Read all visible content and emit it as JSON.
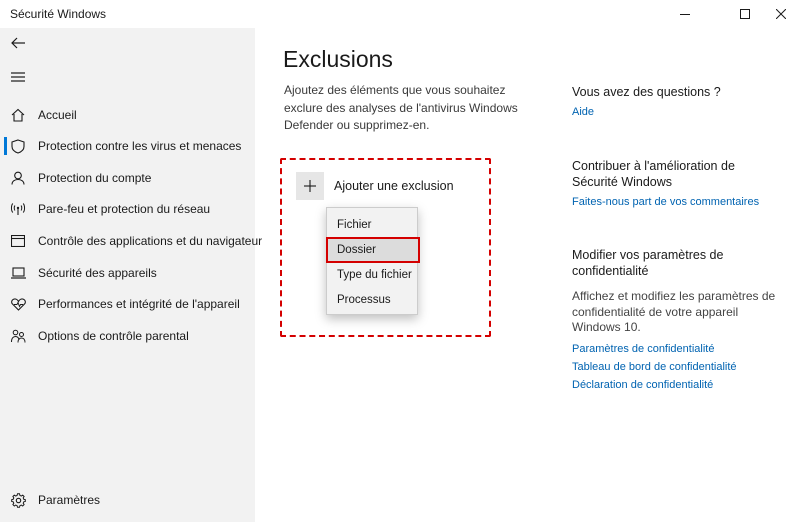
{
  "window": {
    "title": "Sécurité Windows"
  },
  "sidebar": {
    "items": [
      {
        "label": "Accueil",
        "icon": "home-icon"
      },
      {
        "label": "Protection contre les virus et menaces",
        "icon": "shield-icon"
      },
      {
        "label": "Protection du compte",
        "icon": "person-icon"
      },
      {
        "label": "Pare-feu et protection du réseau",
        "icon": "wireless-icon"
      },
      {
        "label": "Contrôle des applications et du navigateur",
        "icon": "app-browser-icon"
      },
      {
        "label": "Sécurité des appareils",
        "icon": "laptop-icon"
      },
      {
        "label": "Performances et intégrité de l'appareil",
        "icon": "heart-icon"
      },
      {
        "label": "Options de contrôle parental",
        "icon": "family-icon"
      }
    ],
    "settings_label": "Paramètres"
  },
  "main": {
    "title": "Exclusions",
    "description": "Ajoutez des éléments que vous souhaitez exclure des analyses de l'antivirus Windows Defender ou supprimez-en.",
    "add_exclusion_label": "Ajouter une exclusion",
    "menu": {
      "items": [
        "Fichier",
        "Dossier",
        "Type du fichier",
        "Processus"
      ],
      "highlighted": "Dossier"
    }
  },
  "right": {
    "questions": {
      "heading": "Vous avez des questions ?",
      "link": "Aide"
    },
    "contribute": {
      "heading": "Contribuer à l'amélioration de Sécurité Windows",
      "link": "Faites-nous part de vos commentaires"
    },
    "privacy": {
      "heading": "Modifier vos paramètres de confidentialité",
      "text": "Affichez et modifiez les paramètres de confidentialité de votre appareil Windows 10.",
      "links": [
        "Paramètres de confidentialité",
        "Tableau de bord de confidentialité",
        "Déclaration de confidentialité"
      ]
    }
  },
  "colors": {
    "accent": "#0078d7",
    "link": "#0063b1",
    "annotation_red": "#d40000",
    "sidebar_bg": "#f2f2f2"
  }
}
